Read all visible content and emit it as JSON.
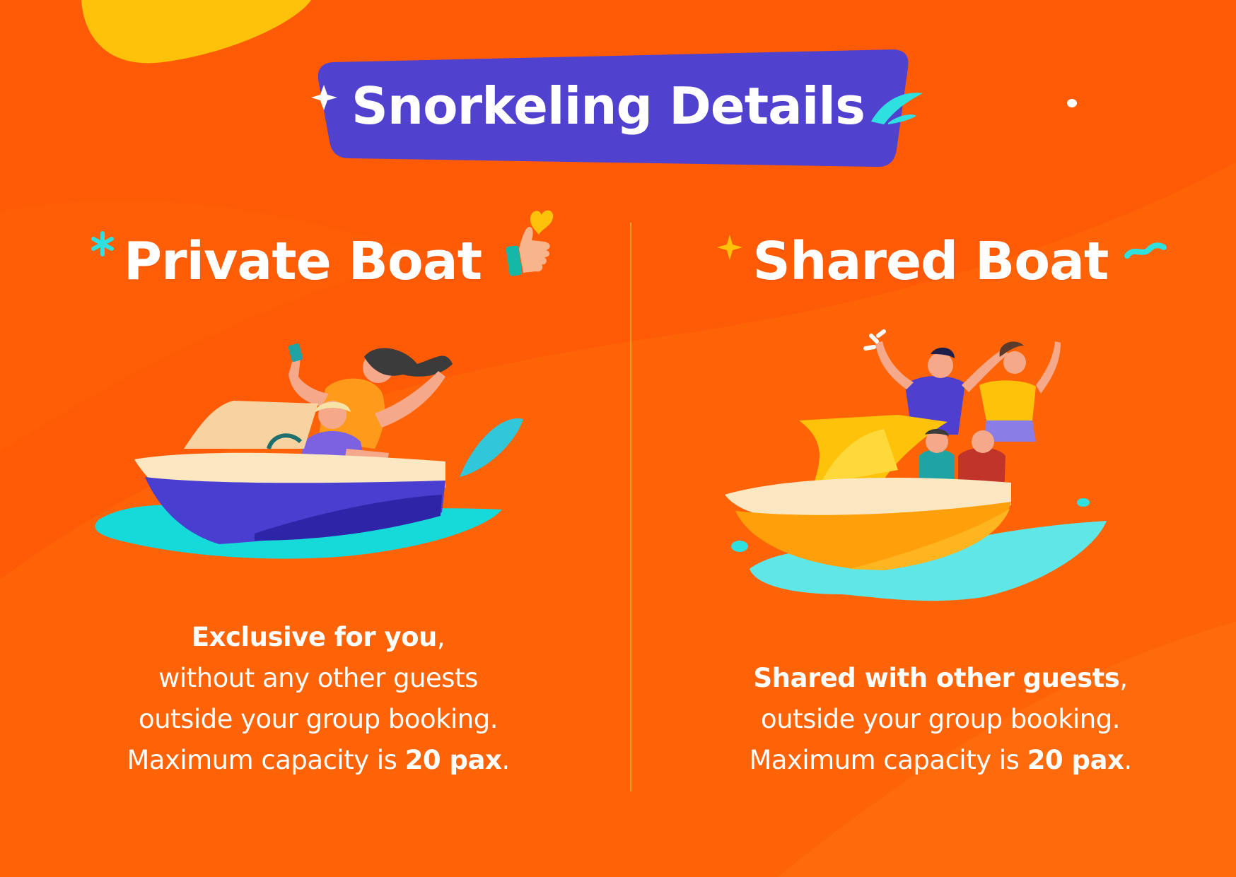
{
  "title": "Snorkeling Details",
  "colors": {
    "background": "#ff5a06",
    "banner": "#5141cf",
    "accent_yellow": "#ffc20a",
    "accent_cyan": "#2ee0e0"
  },
  "private": {
    "heading": "Private Boat",
    "desc": {
      "bold1": "Exclusive for you",
      "comma": ",",
      "line2": "without any other guests",
      "line3": "outside your group booking.",
      "line4_pre": "Maximum capacity is ",
      "capacity": "20 pax",
      "period": "."
    }
  },
  "shared": {
    "heading": "Shared Boat",
    "desc": {
      "bold1": "Shared with other guests",
      "comma": ",",
      "line2": "outside your group booking.",
      "line3_pre": "Maximum capacity is ",
      "capacity": "20 pax",
      "period": "."
    }
  }
}
